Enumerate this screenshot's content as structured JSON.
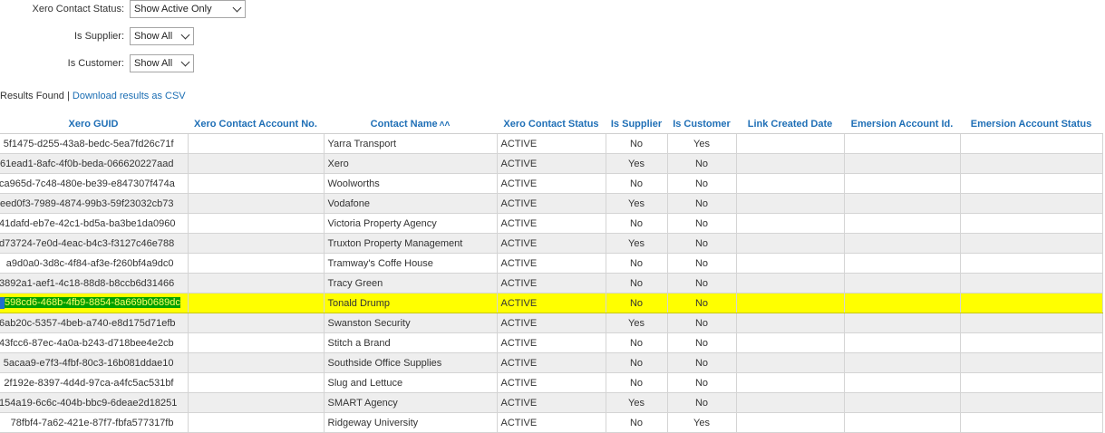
{
  "filters": {
    "status": {
      "label": "Xero Contact Status:",
      "value": "Show Active Only"
    },
    "supplier": {
      "label": "Is Supplier:",
      "value": "Show All"
    },
    "customer": {
      "label": "Is Customer:",
      "value": "Show All"
    }
  },
  "results": {
    "found_text": "Results Found |",
    "download_link": "Download results as CSV"
  },
  "columns": [
    "Xero GUID",
    "Xero Contact Account No.",
    "Contact Name",
    "Xero Contact Status",
    "Is Supplier",
    "Is Customer",
    "Link Created Date",
    "Emersion Account Id.",
    "Emersion Account Status"
  ],
  "sort_icon": "double-chevron-up-icon",
  "selected_row_index": 8,
  "rows": [
    {
      "guid": "5f1475-d255-43a8-bedc-5ea7fd26c71f",
      "account_no": "",
      "name": "Yarra Transport",
      "status": "ACTIVE",
      "supplier": "No",
      "customer": "Yes",
      "link_date": "",
      "emersion_id": "",
      "emersion_status": ""
    },
    {
      "guid": "61ead1-8afc-4f0b-beda-066620227aad",
      "account_no": "",
      "name": "Xero",
      "status": "ACTIVE",
      "supplier": "Yes",
      "customer": "No",
      "link_date": "",
      "emersion_id": "",
      "emersion_status": ""
    },
    {
      "guid": "ca965d-7c48-480e-be39-e847307f474a",
      "account_no": "",
      "name": "Woolworths",
      "status": "ACTIVE",
      "supplier": "No",
      "customer": "No",
      "link_date": "",
      "emersion_id": "",
      "emersion_status": ""
    },
    {
      "guid": "eed0f3-7989-4874-99b3-59f23032cb73",
      "account_no": "",
      "name": "Vodafone",
      "status": "ACTIVE",
      "supplier": "Yes",
      "customer": "No",
      "link_date": "",
      "emersion_id": "",
      "emersion_status": ""
    },
    {
      "guid": "41dafd-eb7e-42c1-bd5a-ba3be1da0960",
      "account_no": "",
      "name": "Victoria Property Agency",
      "status": "ACTIVE",
      "supplier": "No",
      "customer": "No",
      "link_date": "",
      "emersion_id": "",
      "emersion_status": ""
    },
    {
      "guid": "d73724-7e0d-4eac-b4c3-f3127c46e788",
      "account_no": "",
      "name": "Truxton Property Management",
      "status": "ACTIVE",
      "supplier": "Yes",
      "customer": "No",
      "link_date": "",
      "emersion_id": "",
      "emersion_status": ""
    },
    {
      "guid": "a9d0a0-3d8c-4f84-af3e-f260bf4a9dc0",
      "account_no": "",
      "name": "Tramway's Coffe House",
      "status": "ACTIVE",
      "supplier": "No",
      "customer": "No",
      "link_date": "",
      "emersion_id": "",
      "emersion_status": ""
    },
    {
      "guid": "3892a1-aef1-4c18-88d8-b8ccb6d31466",
      "account_no": "",
      "name": "Tracy Green",
      "status": "ACTIVE",
      "supplier": "No",
      "customer": "No",
      "link_date": "",
      "emersion_id": "",
      "emersion_status": ""
    },
    {
      "guid": "598cd6-468b-4fb9-8854-8a669b0689dc",
      "account_no": "",
      "name": "Tonald Drump",
      "status": "ACTIVE",
      "supplier": "No",
      "customer": "No",
      "link_date": "",
      "emersion_id": "",
      "emersion_status": ""
    },
    {
      "guid": "6ab20c-5357-4beb-a740-e8d175d71efb",
      "account_no": "",
      "name": "Swanston Security",
      "status": "ACTIVE",
      "supplier": "Yes",
      "customer": "No",
      "link_date": "",
      "emersion_id": "",
      "emersion_status": ""
    },
    {
      "guid": "43fcc6-87ec-4a0a-b243-d718bee4e2cb",
      "account_no": "",
      "name": "Stitch a Brand",
      "status": "ACTIVE",
      "supplier": "No",
      "customer": "No",
      "link_date": "",
      "emersion_id": "",
      "emersion_status": ""
    },
    {
      "guid": "5acaa9-e7f3-4fbf-80c3-16b081ddae10",
      "account_no": "",
      "name": "Southside Office Supplies",
      "status": "ACTIVE",
      "supplier": "No",
      "customer": "No",
      "link_date": "",
      "emersion_id": "",
      "emersion_status": ""
    },
    {
      "guid": "2f192e-8397-4d4d-97ca-a4fc5ac531bf",
      "account_no": "",
      "name": "Slug and Lettuce",
      "status": "ACTIVE",
      "supplier": "No",
      "customer": "No",
      "link_date": "",
      "emersion_id": "",
      "emersion_status": ""
    },
    {
      "guid": "154a19-6c6c-404b-bbc9-6deae2d18251",
      "account_no": "",
      "name": "SMART Agency",
      "status": "ACTIVE",
      "supplier": "Yes",
      "customer": "No",
      "link_date": "",
      "emersion_id": "",
      "emersion_status": ""
    },
    {
      "guid": "78fbf4-7a62-421e-87f7-fbfa577317fb",
      "account_no": "",
      "name": "Ridgeway University",
      "status": "ACTIVE",
      "supplier": "No",
      "customer": "Yes",
      "link_date": "",
      "emersion_id": "",
      "emersion_status": ""
    }
  ]
}
